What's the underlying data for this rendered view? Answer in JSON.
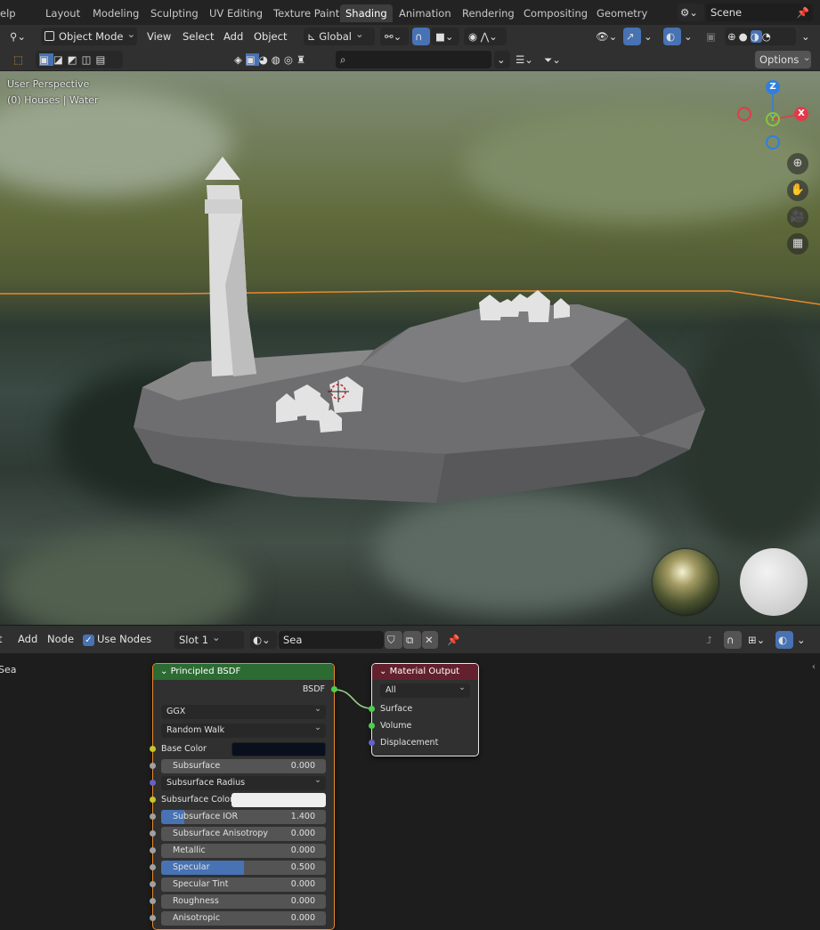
{
  "workspace_tabs": [
    {
      "label": "elp",
      "active": false
    },
    {
      "label": "Layout",
      "active": false
    },
    {
      "label": "Modeling",
      "active": false
    },
    {
      "label": "Sculpting",
      "active": false
    },
    {
      "label": "UV Editing",
      "active": false
    },
    {
      "label": "Texture Paint",
      "active": false
    },
    {
      "label": "Shading",
      "active": true
    },
    {
      "label": "Animation",
      "active": false
    },
    {
      "label": "Rendering",
      "active": false
    },
    {
      "label": "Compositing",
      "active": false
    },
    {
      "label": "Geometry Nodes",
      "active": false
    }
  ],
  "scene": {
    "name": "Scene"
  },
  "viewport_header": {
    "mode": "Object Mode",
    "menus": [
      "View",
      "Select",
      "Add",
      "Object"
    ],
    "transform_orientation": "Global",
    "options_label": "Options",
    "search_placeholder": ""
  },
  "viewport": {
    "perspective_label": "User Perspective",
    "collection_label": "(0) Houses | Water",
    "gizmo_axes": {
      "x": "X",
      "y": "Y",
      "z": "Z"
    }
  },
  "node_header": {
    "menus": [
      "t",
      "Add",
      "Node"
    ],
    "use_nodes_label": "Use Nodes",
    "use_nodes_checked": true,
    "slot": "Slot 1",
    "material": "Sea"
  },
  "node_editor": {
    "side_label": "Sea",
    "principled": {
      "title": "Principled BSDF",
      "output": "BSDF",
      "distribution": "GGX",
      "subsurface_method": "Random Walk",
      "base_color_label": "Base Color",
      "base_color": "#0a0f1e",
      "subsurface": {
        "label": "Subsurface",
        "value": "0.000"
      },
      "subsurface_radius": "Subsurface Radius",
      "subsurface_color_label": "Subsurface Color",
      "subsurface_color": "#efefef",
      "subsurface_ior": {
        "label": "Subsurface IOR",
        "value": "1.400",
        "fill": 0.14
      },
      "subsurface_anisotropy": {
        "label": "Subsurface Anisotropy",
        "value": "0.000"
      },
      "metallic": {
        "label": "Metallic",
        "value": "0.000"
      },
      "specular": {
        "label": "Specular",
        "value": "0.500",
        "fill": 0.5
      },
      "specular_tint": {
        "label": "Specular Tint",
        "value": "0.000"
      },
      "roughness": {
        "label": "Roughness",
        "value": "0.000"
      },
      "anisotropic": {
        "label": "Anisotropic",
        "value": "0.000"
      }
    },
    "material_output": {
      "title": "Material Output",
      "target": "All",
      "inputs": [
        "Surface",
        "Volume",
        "Displacement"
      ]
    }
  },
  "colors": {
    "accent": "#4772b3",
    "selection_outline": "#e8892b",
    "shader_node": "#2c6b32",
    "output_node": "#63212d"
  }
}
